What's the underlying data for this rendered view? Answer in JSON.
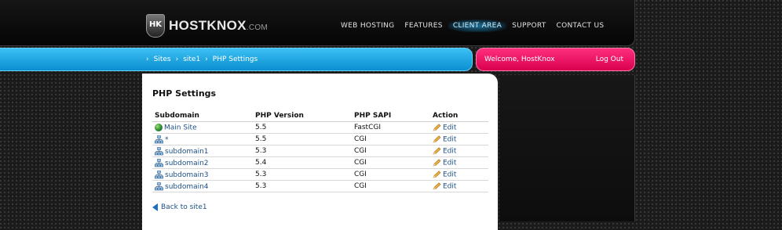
{
  "brand": {
    "name": "HOSTKNOX",
    "suffix": ".COM",
    "emblem": "HK"
  },
  "nav": {
    "items": [
      {
        "label": "WEB HOSTING"
      },
      {
        "label": "FEATURES"
      },
      {
        "label": "CLIENT AREA"
      },
      {
        "label": "SUPPORT"
      },
      {
        "label": "CONTACT US"
      }
    ],
    "active_index": 2
  },
  "breadcrumb": {
    "separator": "›",
    "items": [
      {
        "label": "Sites"
      },
      {
        "label": "site1"
      },
      {
        "label": "PHP Settings"
      }
    ]
  },
  "user": {
    "welcome": "Welcome, HostKnox",
    "logout": "Log Out"
  },
  "page": {
    "title": "PHP Settings"
  },
  "table": {
    "headers": [
      "Subdomain",
      "PHP Version",
      "PHP SAPI",
      "Action"
    ],
    "rows": [
      {
        "icon": "globe-icon",
        "subdomain": "Main Site",
        "version": "5.5",
        "sapi": "FastCGI",
        "action": "Edit"
      },
      {
        "icon": "sitemap-icon",
        "subdomain": "*",
        "version": "5.5",
        "sapi": "CGI",
        "action": "Edit"
      },
      {
        "icon": "sitemap-icon",
        "subdomain": "subdomain1",
        "version": "5.3",
        "sapi": "CGI",
        "action": "Edit"
      },
      {
        "icon": "sitemap-icon",
        "subdomain": "subdomain2",
        "version": "5.4",
        "sapi": "CGI",
        "action": "Edit"
      },
      {
        "icon": "sitemap-icon",
        "subdomain": "subdomain3",
        "version": "5.3",
        "sapi": "CGI",
        "action": "Edit"
      },
      {
        "icon": "sitemap-icon",
        "subdomain": "subdomain4",
        "version": "5.3",
        "sapi": "CGI",
        "action": "Edit"
      }
    ]
  },
  "back_link": {
    "label": "Back to site1"
  },
  "colors": {
    "accent_blue": "#0a8ed0",
    "accent_pink": "#d8004f",
    "link": "#1a4f86"
  }
}
